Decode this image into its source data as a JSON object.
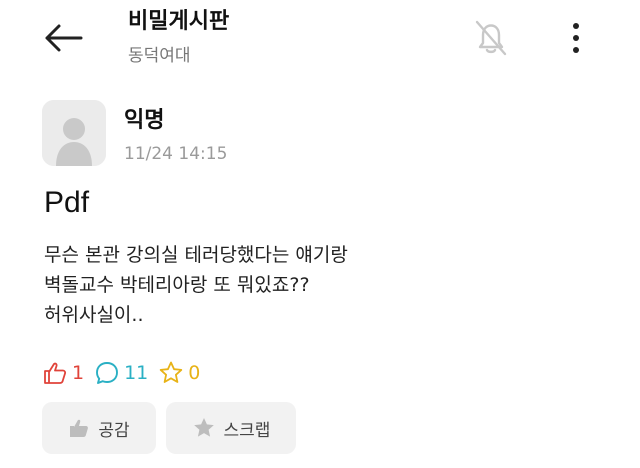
{
  "header": {
    "title": "비밀게시판",
    "subtitle": "동덕여대",
    "icons": [
      "back-arrow-icon",
      "bell-off-icon",
      "more-vertical-icon"
    ]
  },
  "post": {
    "author": "익명",
    "timestamp": "11/24 14:15",
    "title": "Pdf",
    "body_lines": [
      "무슨 본관 강의실 테러당했다는 얘기랑",
      "벽돌교수 박테리아랑 또 뭐있죠??",
      "허위사실이.."
    ]
  },
  "stats": {
    "likes": "1",
    "comments": "11",
    "scraps": "0"
  },
  "actions": {
    "like_label": "공감",
    "scrap_label": "스크랩"
  },
  "colors": {
    "like": "#e0433a",
    "comment": "#2ab0c4",
    "scrap": "#e8b317",
    "button_bg": "#f2f2f2"
  }
}
